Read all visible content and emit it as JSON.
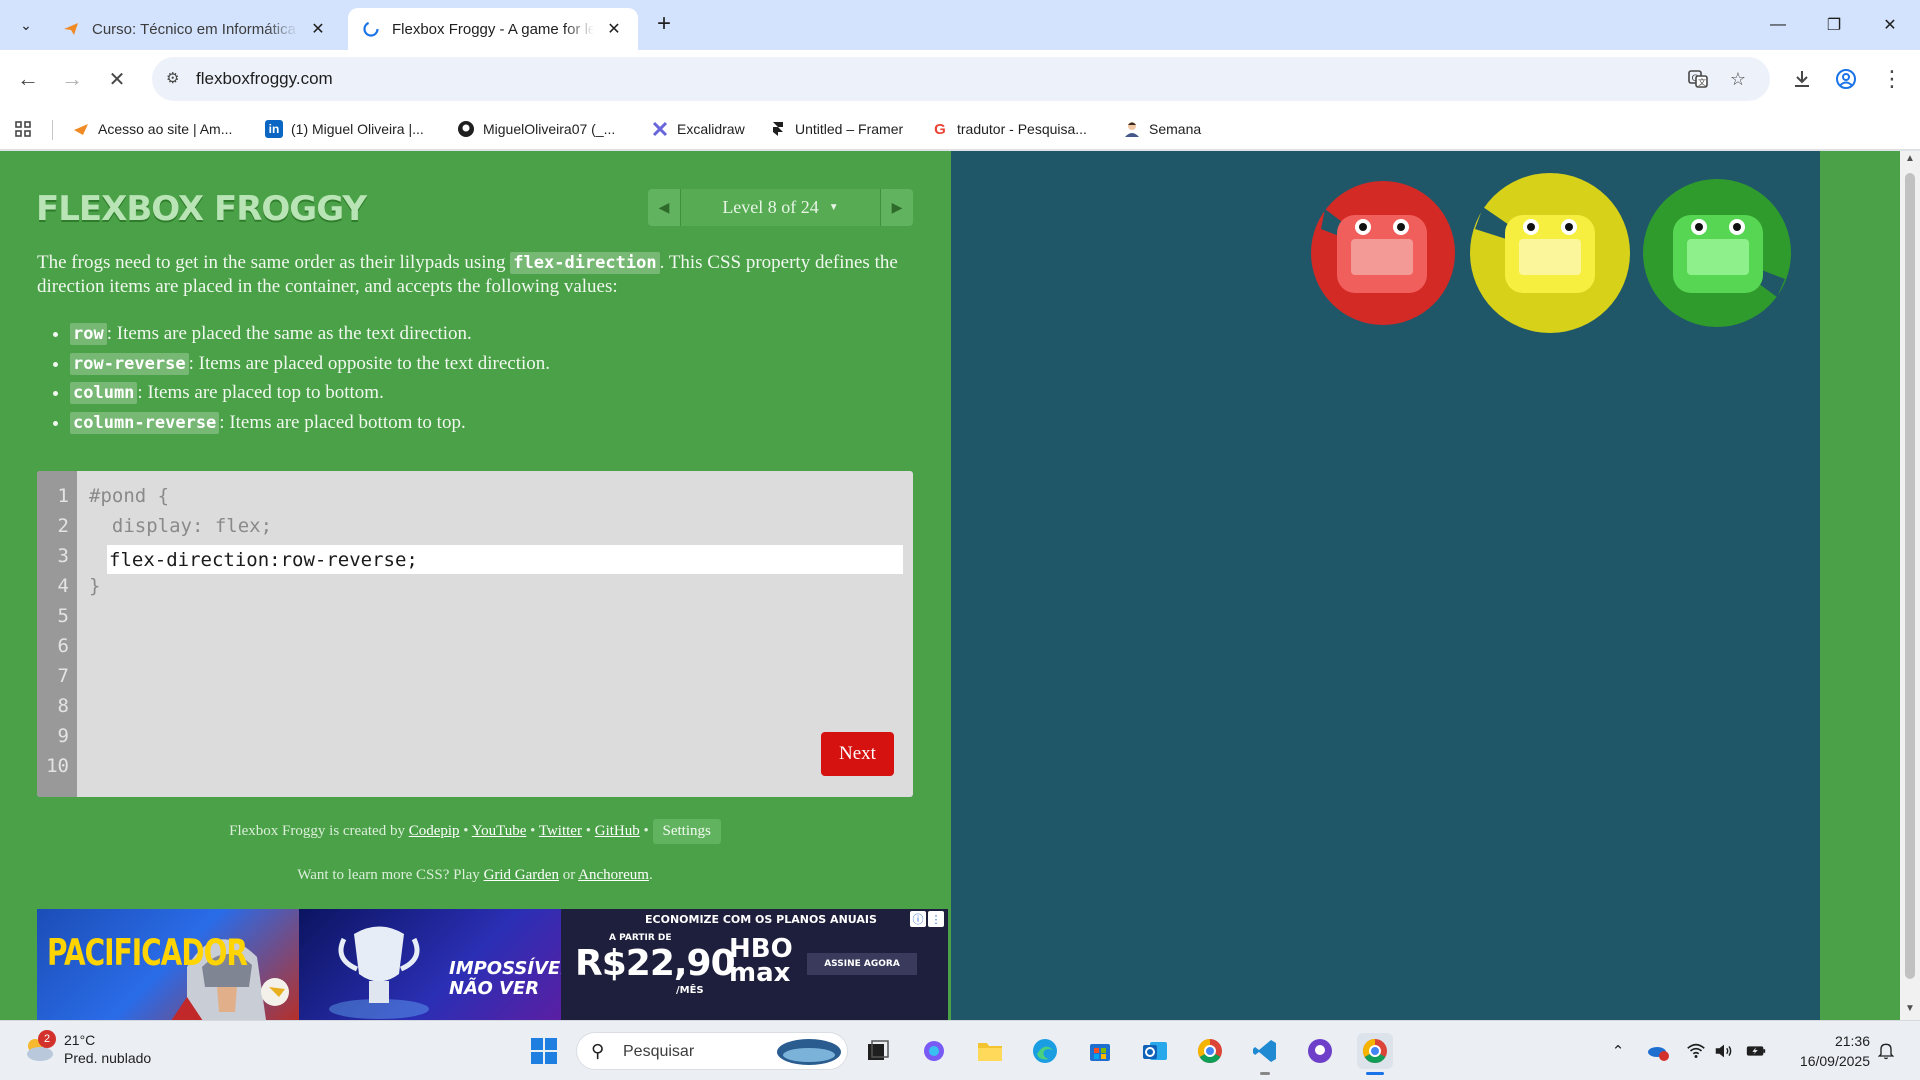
{
  "browser": {
    "tabs": [
      {
        "title": "Curso: Técnico em Informática - Ir",
        "active": false
      },
      {
        "title": "Flexbox Froggy - A game for learn",
        "active": true
      }
    ],
    "url": "flexboxfroggy.com",
    "bookmarks": [
      {
        "label": "Acesso ao site | Am...",
        "icon": "paper-plane-icon"
      },
      {
        "label": "(1) Miguel Oliveira |...",
        "icon": "linkedin-icon"
      },
      {
        "label": "MiguelOliveira07 (_...",
        "icon": "github-icon"
      },
      {
        "label": "Excalidraw",
        "icon": "excalidraw-icon"
      },
      {
        "label": "Untitled – Framer",
        "icon": "framer-icon"
      },
      {
        "label": "tradutor - Pesquisa...",
        "icon": "google-icon"
      },
      {
        "label": "Semana",
        "icon": "person-icon"
      }
    ]
  },
  "game": {
    "logo": "FLEXBOX FROGGY",
    "level": "Level 8 of 24",
    "instructions": {
      "before": "The frogs need to get in the same order as their lilypads using ",
      "keyword": "flex-direction",
      "after": ". This CSS property defines the direction items are placed in the container, and accepts the following values:"
    },
    "values": [
      {
        "code": "row",
        "desc": ": Items are placed the same as the text direction."
      },
      {
        "code": "row-reverse",
        "desc": ": Items are placed opposite to the text direction."
      },
      {
        "code": "column",
        "desc": ": Items are placed top to bottom."
      },
      {
        "code": "column-reverse",
        "desc": ": Items are placed bottom to top."
      }
    ],
    "editor": {
      "line_numbers": [
        "1",
        "2",
        "3",
        "4",
        "5",
        "6",
        "7",
        "8",
        "9",
        "10"
      ],
      "line1": "#pond {",
      "line2": "  display: flex;",
      "input_value": "flex-direction:row-reverse;",
      "line4": "}"
    },
    "next_label": "Next",
    "credits": {
      "prefix": "Flexbox Froggy is created by ",
      "links": [
        "Codepip",
        "YouTube",
        "Twitter",
        "GitHub"
      ],
      "settings": "Settings"
    },
    "learn_more": {
      "prefix": "Want to learn more CSS? Play ",
      "link1": "Grid Garden",
      "middle": " or ",
      "link2": "Anchoreum",
      "suffix": "."
    },
    "frogs": [
      {
        "color": "red",
        "pad": "#d42a26",
        "body": "#f15f5c"
      },
      {
        "color": "yellow",
        "pad": "#d7d119",
        "body": "#f6ef3f"
      },
      {
        "color": "green",
        "pad": "#2f9b2c",
        "body": "#57d653"
      }
    ]
  },
  "ad": {
    "panel1": "PACIFICADOR",
    "panel2": "IMPOSSÍVEL NÃO VER",
    "panel3_header": "ECONOMIZE COM OS PLANOS ANUAIS",
    "panel3_from": "A PARTIR DE",
    "panel3_price": "R$22,90",
    "panel3_unit": "/MÊS",
    "panel3_brand": "HBO max",
    "panel3_cta": "ASSINE AGORA"
  },
  "taskbar": {
    "weather_temp": "21°C",
    "weather_desc": "Pred. nublado",
    "weather_badge": "2",
    "search_placeholder": "Pesquisar",
    "time": "21:36",
    "date": "16/09/2025"
  }
}
